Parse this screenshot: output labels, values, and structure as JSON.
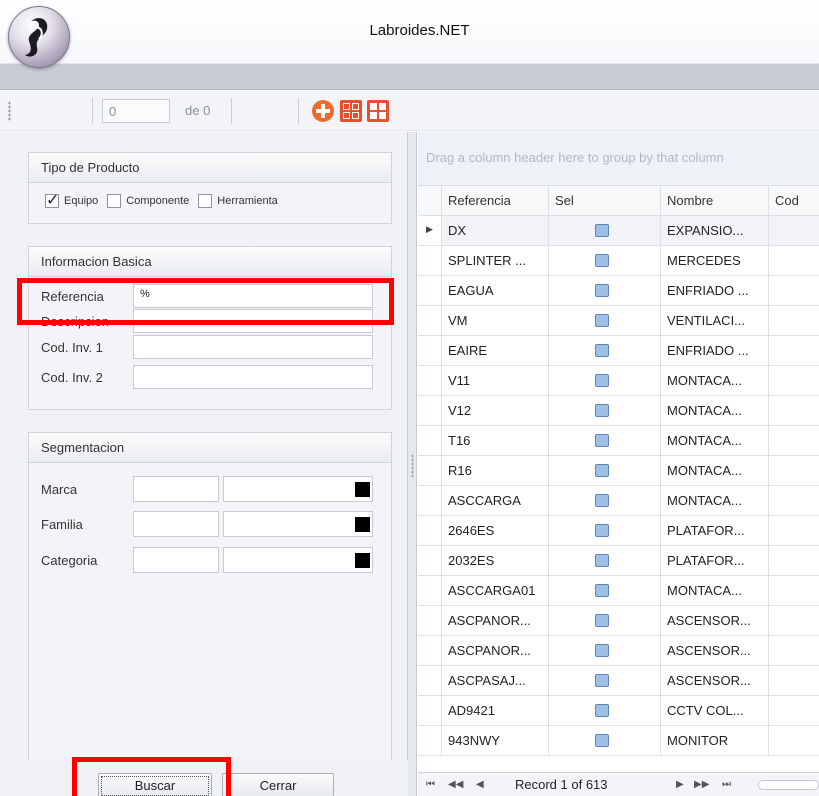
{
  "window": {
    "title": "Labroides.NET"
  },
  "toolbar": {
    "position_value": "0",
    "of_label": "de 0",
    "icons": [
      "add-icon",
      "grid-icon",
      "grid-solid-icon"
    ]
  },
  "tipo_producto": {
    "title": "Tipo de Producto",
    "options": [
      {
        "label": "Equipo",
        "checked": true
      },
      {
        "label": "Componente",
        "checked": false
      },
      {
        "label": "Herramienta",
        "checked": false
      }
    ]
  },
  "informacion_basica": {
    "title": "Informacion Basica",
    "fields": [
      {
        "label": "Referencia",
        "value": "%"
      },
      {
        "label": "Descripcion",
        "value": ""
      },
      {
        "label": "Cod. Inv. 1",
        "value": ""
      },
      {
        "label": "Cod. Inv. 2",
        "value": ""
      }
    ]
  },
  "segmentacion": {
    "title": "Segmentacion",
    "fields": [
      {
        "label": "Marca"
      },
      {
        "label": "Familia"
      },
      {
        "label": "Categoria"
      }
    ]
  },
  "buttons": {
    "buscar": "Buscar",
    "cerrar": "Cerrar"
  },
  "grid": {
    "group_hint": "Drag a column header here to group by that column",
    "columns": [
      "Referencia",
      "Sel",
      "Nombre",
      "Cod"
    ],
    "rows": [
      {
        "ref": "DX",
        "nombre": "EXPANSIO..."
      },
      {
        "ref": "SPLINTER ...",
        "nombre": "MERCEDES"
      },
      {
        "ref": "EAGUA",
        "nombre": "ENFRIADO ..."
      },
      {
        "ref": "VM",
        "nombre": "VENTILACI..."
      },
      {
        "ref": "EAIRE",
        "nombre": "ENFRIADO ..."
      },
      {
        "ref": "V11",
        "nombre": "MONTACA..."
      },
      {
        "ref": "V12",
        "nombre": "MONTACA..."
      },
      {
        "ref": "T16",
        "nombre": "MONTACA..."
      },
      {
        "ref": "R16",
        "nombre": "MONTACA..."
      },
      {
        "ref": "ASCCARGA",
        "nombre": "MONTACA..."
      },
      {
        "ref": "2646ES",
        "nombre": "PLATAFOR..."
      },
      {
        "ref": "2032ES",
        "nombre": "PLATAFOR..."
      },
      {
        "ref": "ASCCARGA01",
        "nombre": "MONTACA..."
      },
      {
        "ref": "ASCPANOR...",
        "nombre": "ASCENSOR..."
      },
      {
        "ref": "ASCPANOR...",
        "nombre": "ASCENSOR..."
      },
      {
        "ref": "ASCPASAJ...",
        "nombre": "ASCENSOR..."
      },
      {
        "ref": "AD9421",
        "nombre": "CCTV COL..."
      },
      {
        "ref": "943NWY",
        "nombre": "MONITOR"
      }
    ],
    "pager": {
      "record_text": "Record 1 of 613",
      "first": "⏮",
      "prev_page": "◀◀",
      "prev": "◀",
      "next": "▶",
      "next_page": "▶▶",
      "last": "⏭"
    }
  }
}
